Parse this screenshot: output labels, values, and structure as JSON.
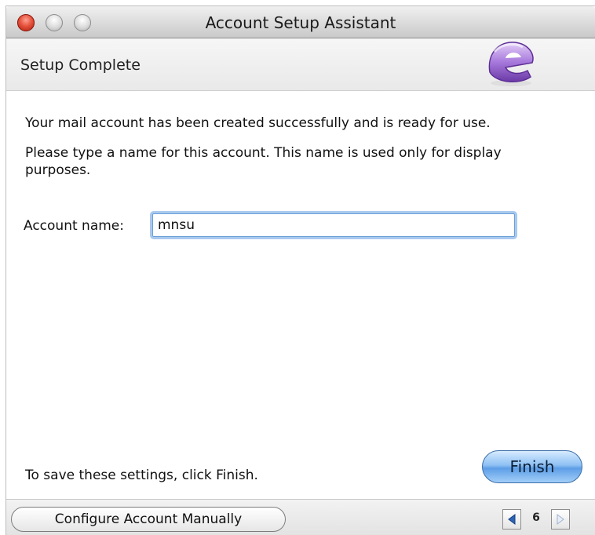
{
  "window": {
    "title": "Account Setup Assistant"
  },
  "header": {
    "page_title": "Setup Complete",
    "logo_icon": "entourage-logo-icon"
  },
  "content": {
    "success_message": "Your mail account has been created successfully and is ready for use.",
    "instruction": "Please type a name for this account. This name is used only for display purposes.",
    "account_name_label": "Account name:",
    "account_name_value": "mnsu"
  },
  "footer": {
    "save_hint": "To save these settings, click Finish.",
    "finish_label": "Finish",
    "configure_manually_label": "Configure Account Manually",
    "page_number": "6"
  },
  "colors": {
    "accent_blue": "#5d9ee6",
    "focus_ring": "#a9c9ee",
    "close_red": "#e34f3a",
    "logo_purple": "#8e5bc9"
  }
}
